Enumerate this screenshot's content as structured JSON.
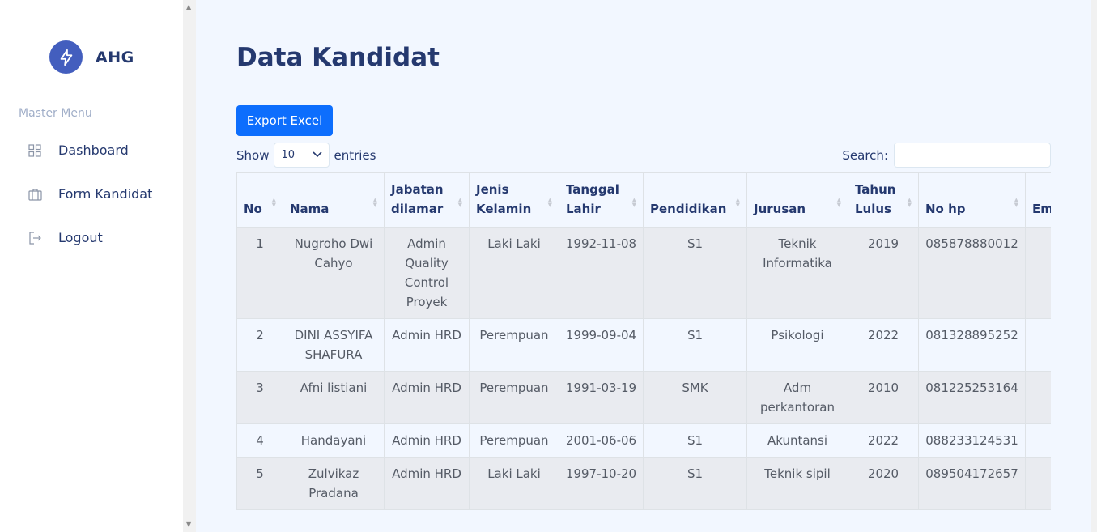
{
  "brand": {
    "name": "AHG"
  },
  "sidebar": {
    "section_title": "Master Menu",
    "items": [
      {
        "label": "Dashboard",
        "icon": "grid-icon"
      },
      {
        "label": "Form Kandidat",
        "icon": "briefcase-icon"
      },
      {
        "label": "Logout",
        "icon": "logout-icon"
      }
    ]
  },
  "main": {
    "title": "Data Kandidat",
    "export_label": "Export Excel",
    "show_label": "Show",
    "entries_label": "entries",
    "page_length": "10",
    "search_label": "Search:",
    "search_value": ""
  },
  "table": {
    "headers": [
      "No",
      "Nama",
      "Jabatan dilamar",
      "Jenis Kelamin",
      "Tanggal Lahir",
      "Pendidikan",
      "Jurusan",
      "Tahun Lulus",
      "No hp",
      "Em"
    ],
    "rows": [
      [
        "1",
        "Nugroho Dwi Cahyo",
        "Admin Quality Control Proyek",
        "Laki Laki",
        "1992-11-08",
        "S1",
        "Teknik Informatika",
        "2019",
        "085878880012",
        ""
      ],
      [
        "2",
        "DINI ASSYIFA SHAFURA",
        "Admin HRD",
        "Perempuan",
        "1999-09-04",
        "S1",
        "Psikologi",
        "2022",
        "081328895252",
        ""
      ],
      [
        "3",
        "Afni listiani",
        "Admin HRD",
        "Perempuan",
        "1991-03-19",
        "SMK",
        "Adm perkantoran",
        "2010",
        "081225253164",
        ""
      ],
      [
        "4",
        "Handayani",
        "Admin HRD",
        "Perempuan",
        "2001-06-06",
        "S1",
        "Akuntansi",
        "2022",
        "088233124531",
        ""
      ],
      [
        "5",
        "Zulvikaz Pradana",
        "Admin HRD",
        "Laki Laki",
        "1997-10-20",
        "S1",
        "Teknik sipil",
        "2020",
        "089504172657",
        ""
      ]
    ]
  },
  "colors": {
    "accent": "#435ebe",
    "button": "#0d6efd",
    "main_bg": "#f2f7ff",
    "text": "#25396f"
  }
}
